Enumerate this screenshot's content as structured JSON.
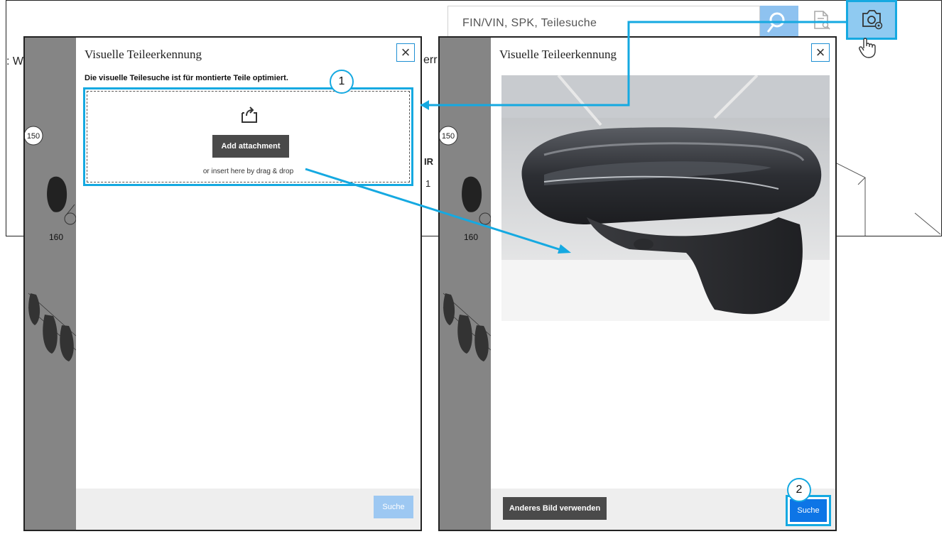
{
  "header": {
    "search_placeholder": "FIN/VIN, SPK, Teilesuche",
    "left_fragment": ": W",
    "behind_fragment": "err"
  },
  "diagram_labels": {
    "label_150": "150",
    "label_160": "160",
    "fragment_r": "IR",
    "fragment_1": "1"
  },
  "dialog_upload": {
    "title": "Visuelle Teileerkennung",
    "intro": "Die visuelle Teilesuche ist für montierte Teile optimiert.",
    "add_attachment": "Add attachment",
    "drag_drop": "or insert here by drag & drop",
    "search_label": "Suche"
  },
  "dialog_preview": {
    "title": "Visuelle Teileerkennung",
    "other_image_label": "Anderes Bild verwenden",
    "search_label": "Suche"
  },
  "callouts": {
    "one": "1",
    "two": "2"
  },
  "colors": {
    "highlight": "#15a9e1",
    "primary_button": "#0d75e6",
    "disabled_button": "#9dc8f2",
    "dark_button": "#4a4a4a"
  },
  "icons": [
    "search-icon",
    "document-search-icon",
    "camera-icon",
    "hand-pointer-icon",
    "upload-icon",
    "close-icon"
  ]
}
